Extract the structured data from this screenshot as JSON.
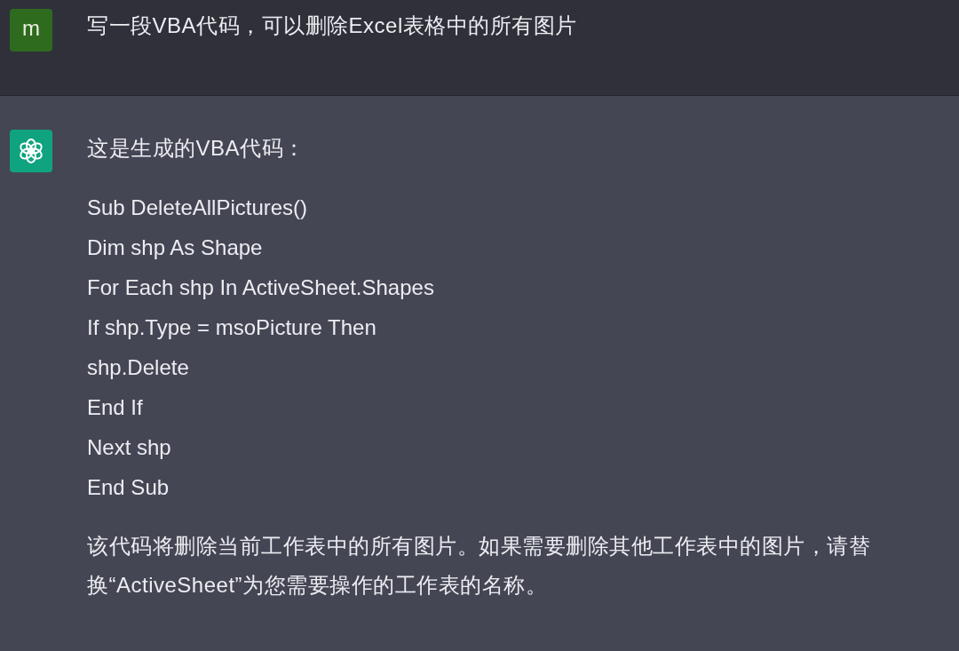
{
  "messages": [
    {
      "kind": "user",
      "avatar": "m",
      "blocks": [
        {
          "kind": "paragraph",
          "text": "写一段VBA代码，可以删除Excel表格中的所有图片"
        }
      ]
    },
    {
      "kind": "assistant",
      "blocks": [
        {
          "kind": "paragraph",
          "text": "这是生成的VBA代码："
        },
        {
          "kind": "code",
          "lines": [
            "Sub DeleteAllPictures()",
            "Dim shp As Shape",
            "For Each shp In ActiveSheet.Shapes",
            "If shp.Type = msoPicture Then",
            "shp.Delete",
            "End If",
            "Next shp",
            "End Sub"
          ]
        },
        {
          "kind": "paragraph",
          "text": "该代码将删除当前工作表中的所有图片。如果需要删除其他工作表中的图片，请替换“ActiveSheet”为您需要操作的工作表的名称。"
        }
      ]
    }
  ]
}
